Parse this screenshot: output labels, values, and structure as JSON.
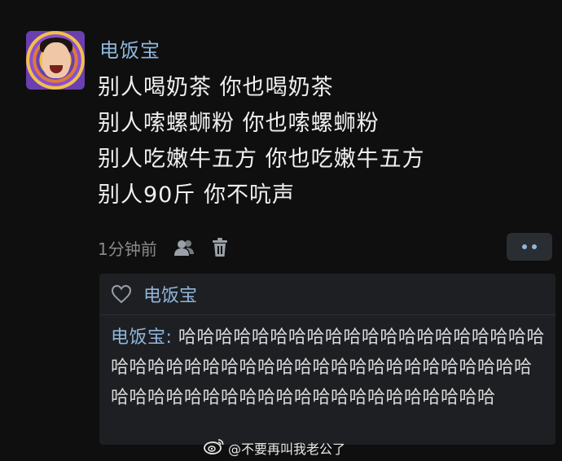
{
  "post": {
    "username": "电饭宝",
    "lines": [
      "别人喝奶茶 你也喝奶茶",
      "别人嗦螺蛳粉 你也嗦螺蛳粉",
      "别人吃嫩牛五方 你也吃嫩牛五方",
      "别人90斤 你不吭声"
    ],
    "time": "1分钟前",
    "icons": [
      "people-icon",
      "trash-icon",
      "more-icon"
    ]
  },
  "reply": {
    "liker": "电饭宝",
    "author": "电饭宝:",
    "text": " 哈哈哈哈哈哈哈哈哈哈哈哈哈哈哈哈哈哈哈哈哈哈哈哈哈哈哈哈哈哈哈哈哈哈哈哈哈哈哈哈哈哈哈哈哈哈哈哈哈哈哈哈哈哈哈哈哈哈哈哈哈哈哈哈"
  },
  "watermark": {
    "text": "@不要再叫我老公了"
  },
  "colors": {
    "background": "#0f0f0f",
    "accent": "#8fb6dc",
    "reply_bg": "#1e1f22"
  }
}
